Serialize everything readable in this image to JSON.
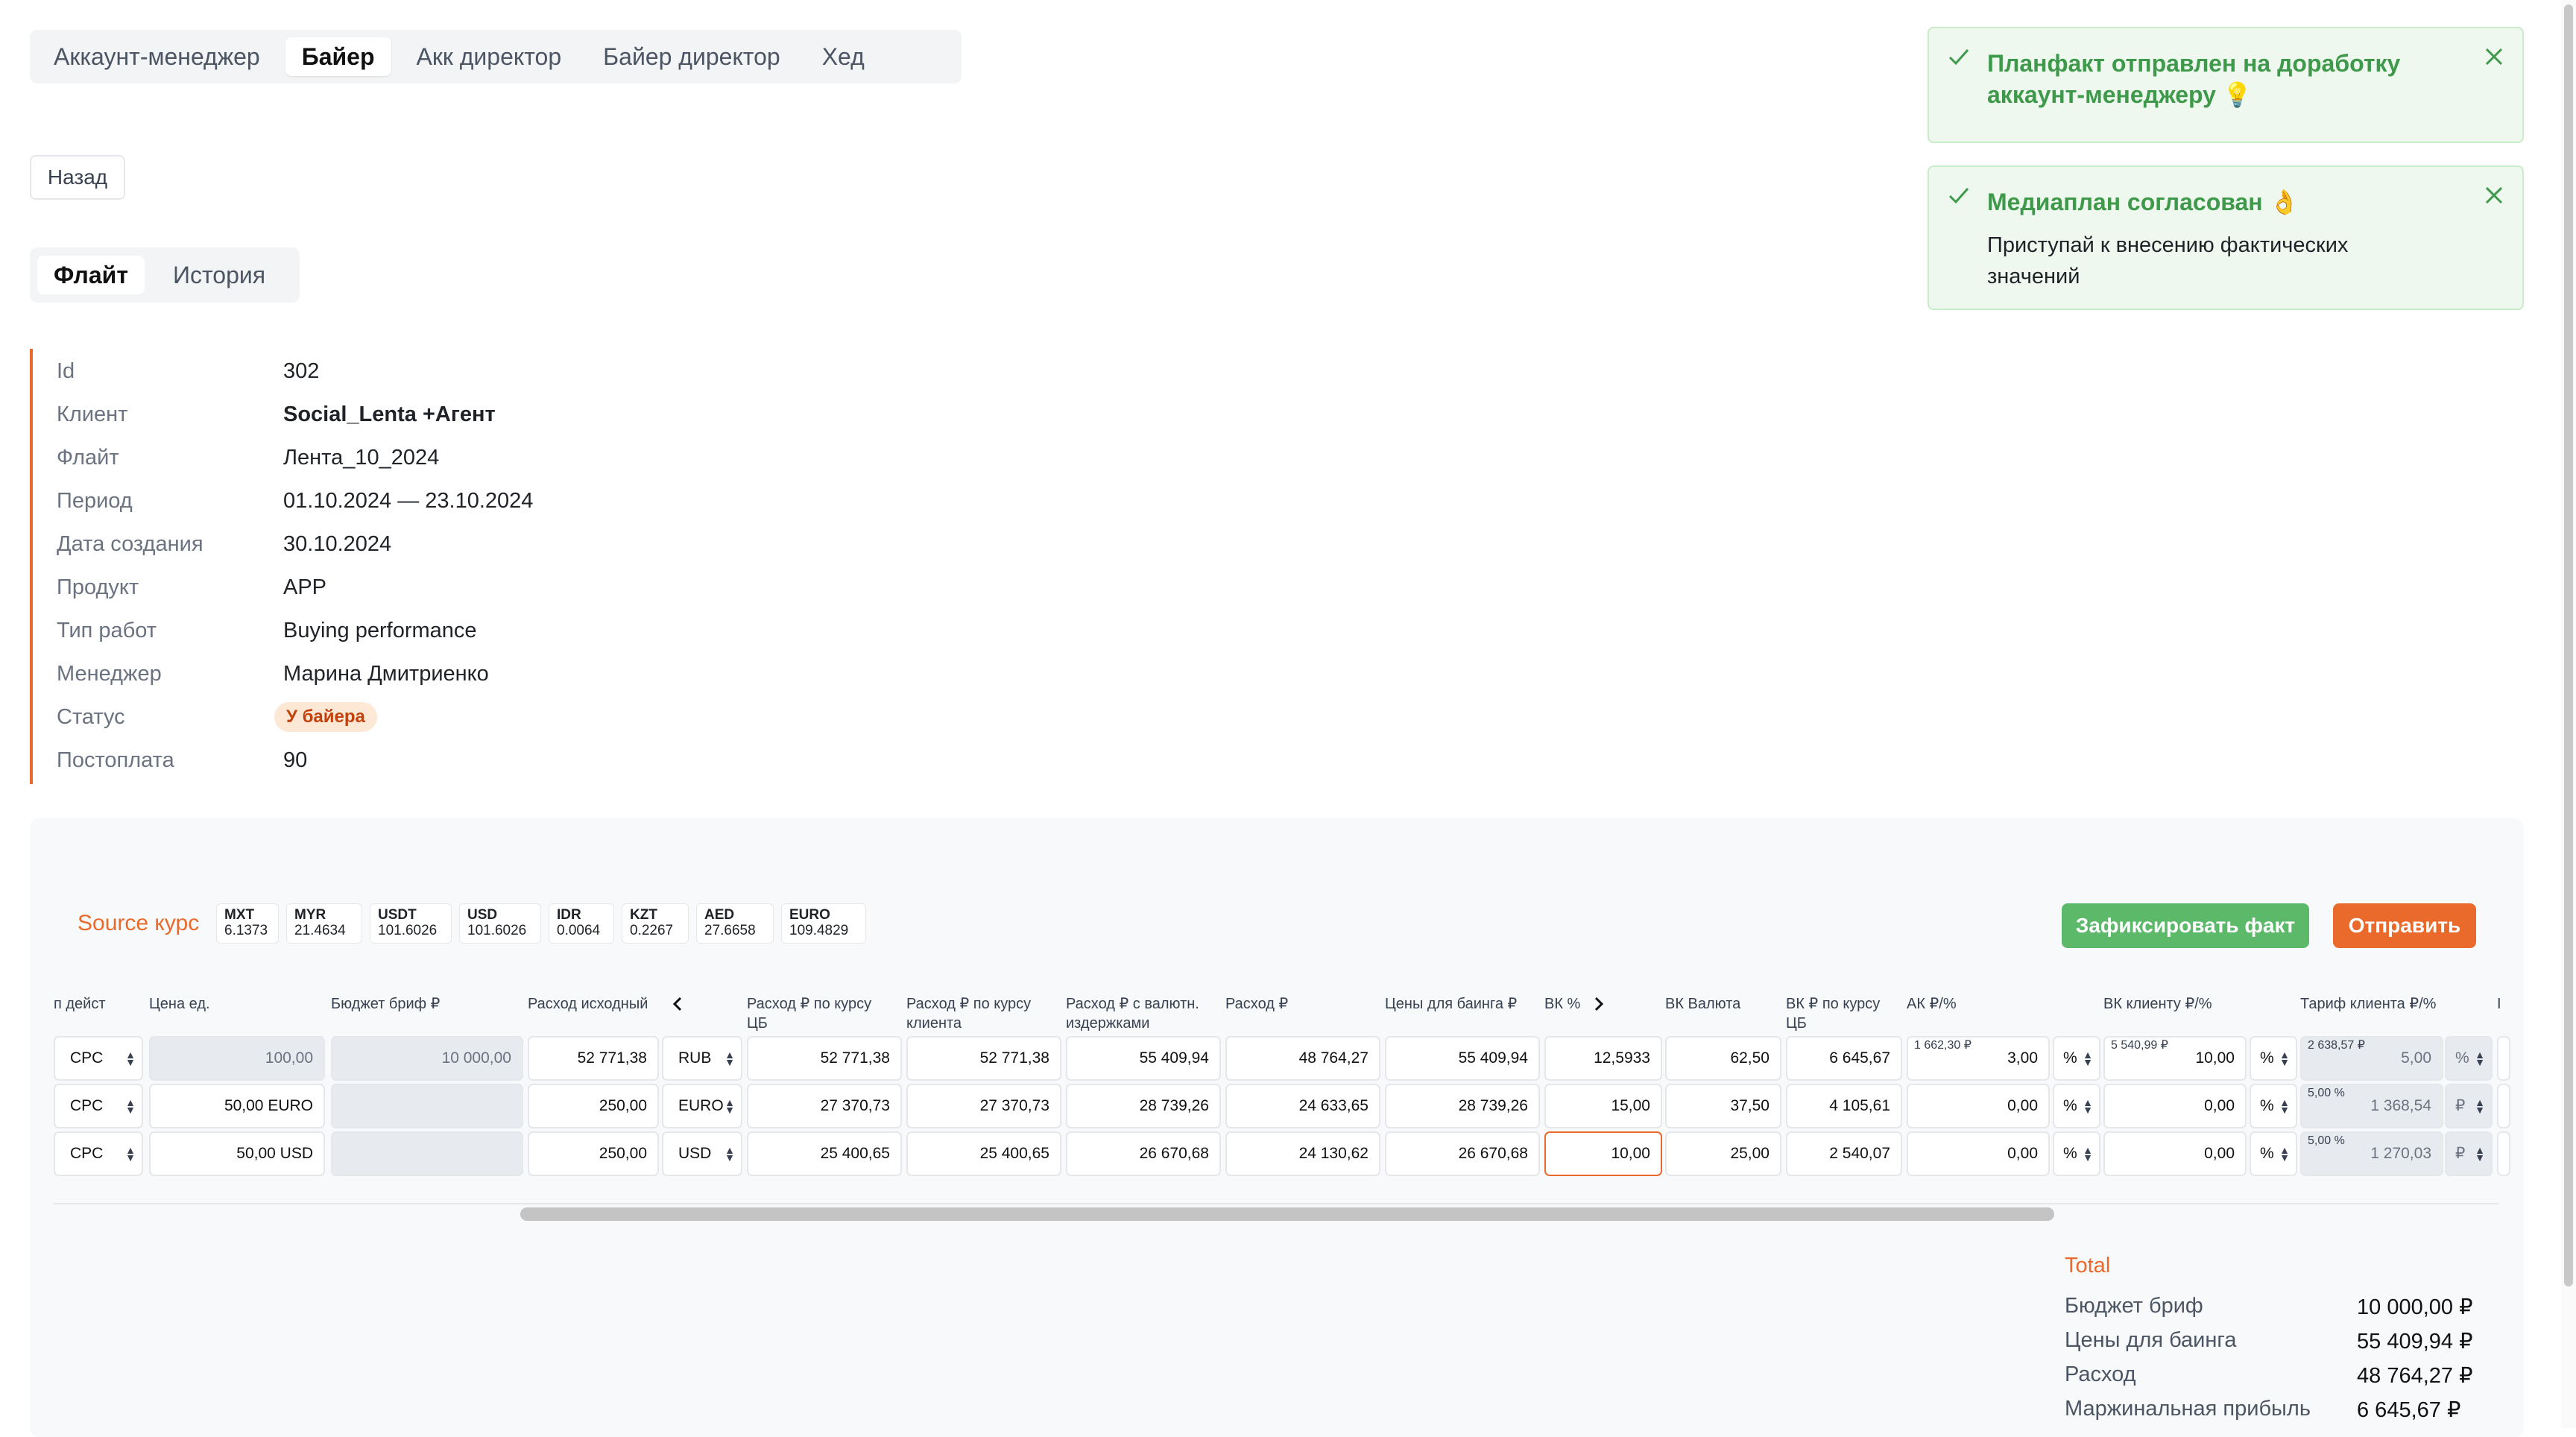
{
  "role_tabs": [
    "Аккаунт-менеджер",
    "Байер",
    "Акк директор",
    "Байер директор",
    "Хед"
  ],
  "active_role": "Байер",
  "back_label": "Назад",
  "sub_tabs": [
    "Флайт",
    "История"
  ],
  "info": {
    "id_label": "Id",
    "id": "302",
    "client_label": "Клиент",
    "client": "Social_Lenta +Агент",
    "flight_label": "Флайт",
    "flight": "Лента_10_2024",
    "period_label": "Период",
    "period": "01.10.2024 — 23.10.2024",
    "created_label": "Дата создания",
    "created": "30.10.2024",
    "product_label": "Продукт",
    "product": "APP",
    "work_type_label": "Тип работ",
    "work_type": "Buying performance",
    "manager_label": "Менеджер",
    "manager": "Марина Дмитриенко",
    "status_label": "Статус",
    "status": "У байера",
    "postpay_label": "Постоплата",
    "postpay": "90"
  },
  "toasts": [
    {
      "title_line1": "Планфакт отправлен на доработку",
      "title_line2": "аккаунт-менеджеру 💡"
    },
    {
      "title": "Медиаплан согласован 👌",
      "desc_line1": "Приступай к внесению фактических",
      "desc_line2": "значений"
    }
  ],
  "source_rate_label": "Source курс",
  "rates": [
    {
      "code": "MXT",
      "value": "6.1373"
    },
    {
      "code": "MYR",
      "value": "21.4634"
    },
    {
      "code": "USDT",
      "value": "101.6026"
    },
    {
      "code": "USD",
      "value": "101.6026"
    },
    {
      "code": "IDR",
      "value": "0.0064"
    },
    {
      "code": "KZT",
      "value": "0.2267"
    },
    {
      "code": "AED",
      "value": "27.6658"
    },
    {
      "code": "EURO",
      "value": "109.4829"
    }
  ],
  "buttons": {
    "fix": "Зафиксировать факт",
    "send": "Отправить"
  },
  "table": {
    "headers": {
      "action": "п дейст",
      "unit_price": "Цена ед.",
      "brief_budget": "Бюджет бриф ₽",
      "source_spend": "Расход исходный",
      "spend_cb_1": "Расход ₽ по курсу",
      "spend_cb_2": "ЦБ",
      "spend_client_1": "Расход ₽ по курсу",
      "spend_client_2": "клиента",
      "spend_fx_1": "Расход ₽ с валютн.",
      "spend_fx_2": "издержками",
      "spend_rub": "Расход ₽",
      "buying_price": "Цены для баинга ₽",
      "vk_pct": "ВК %",
      "vk_currency": "ВК Валюта",
      "vk_cb_1": "ВК ₽ по курсу",
      "vk_cb_2": "ЦБ",
      "ak": "АК ₽/%",
      "vk_client": "ВК клиенту ₽/%",
      "client_tariff": "Тариф клиента ₽/%",
      "last": "I"
    },
    "rows": [
      {
        "action": "CPC",
        "unit_price": "100,00",
        "brief_budget": "10 000,00",
        "source_spend": "52 771,38",
        "currency": "RUB",
        "spend_cb": "52 771,38",
        "spend_client": "52 771,38",
        "spend_fx": "55 409,94",
        "spend_rub": "48 764,27",
        "buying_price": "55 409,94",
        "vk_pct": "12,5933",
        "vk_currency": "62,50",
        "vk_cb": "6 645,67",
        "ak_small": "1 662,30 ₽",
        "ak": "3,00",
        "ak_unit": "%",
        "vk_client_small": "5 540,99 ₽",
        "vk_client": "10,00",
        "vk_client_unit": "%",
        "tariff_small": "2 638,57 ₽",
        "tariff": "5,00",
        "tariff_unit": "%"
      },
      {
        "action": "CPC",
        "unit_price": "50,00 EURO",
        "brief_budget": "",
        "source_spend": "250,00",
        "currency": "EURO",
        "spend_cb": "27 370,73",
        "spend_client": "27 370,73",
        "spend_fx": "28 739,26",
        "spend_rub": "24 633,65",
        "buying_price": "28 739,26",
        "vk_pct": "15,00",
        "vk_currency": "37,50",
        "vk_cb": "4 105,61",
        "ak_small": "",
        "ak": "0,00",
        "ak_unit": "%",
        "vk_client_small": "",
        "vk_client": "0,00",
        "vk_client_unit": "%",
        "tariff_small": "5,00 %",
        "tariff": "1 368,54",
        "tariff_unit": "₽"
      },
      {
        "action": "CPC",
        "unit_price": "50,00 USD",
        "brief_budget": "",
        "source_spend": "250,00",
        "currency": "USD",
        "spend_cb": "25 400,65",
        "spend_client": "25 400,65",
        "spend_fx": "26 670,68",
        "spend_rub": "24 130,62",
        "buying_price": "26 670,68",
        "vk_pct": "10,00",
        "vk_currency": "25,00",
        "vk_cb": "2 540,07",
        "ak_small": "",
        "ak": "0,00",
        "ak_unit": "%",
        "vk_client_small": "",
        "vk_client": "0,00",
        "vk_client_unit": "%",
        "tariff_small": "5,00 %",
        "tariff": "1 270,03",
        "tariff_unit": "₽"
      }
    ]
  },
  "total": {
    "title": "Total",
    "items": [
      {
        "label": "Бюджет бриф",
        "value": "10 000,00 ₽"
      },
      {
        "label": "Цены для баинга",
        "value": "55 409,94 ₽"
      },
      {
        "label": "Расход",
        "value": "48 764,27 ₽"
      },
      {
        "label": "Маржинальная прибыль",
        "value": "6 645,67 ₽"
      }
    ]
  },
  "colors": {
    "accent": "#ea6a2b",
    "success": "#5cb96a",
    "toast_bg": "#eef8ef",
    "badge_bg": "#fde7d5"
  }
}
